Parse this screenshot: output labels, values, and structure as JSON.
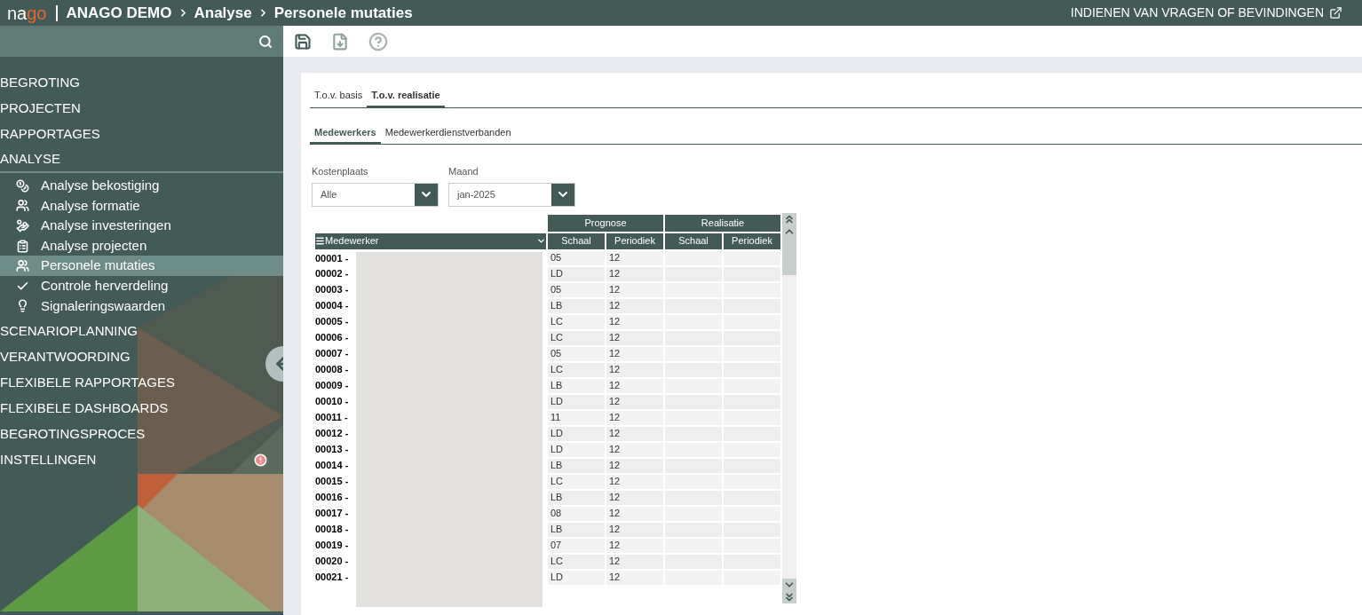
{
  "header": {
    "logo_light": "na",
    "logo_accent": "go",
    "breadcrumb": [
      "ANAGO DEMO",
      "Analyse",
      "Personele mutaties"
    ],
    "feedback_link": "INDIENEN VAN VRAGEN OF BEVINDINGEN"
  },
  "sidebar": {
    "items": [
      {
        "label": "BEGROTING",
        "expanded": false
      },
      {
        "label": "PROJECTEN",
        "expanded": false
      },
      {
        "label": "RAPPORTAGES",
        "expanded": false
      },
      {
        "label": "ANALYSE",
        "expanded": true,
        "children": [
          {
            "label": "Analyse bekostiging",
            "selected": false
          },
          {
            "label": "Analyse formatie",
            "selected": false
          },
          {
            "label": "Analyse investeringen",
            "selected": false
          },
          {
            "label": "Analyse projecten",
            "selected": false
          },
          {
            "label": "Personele mutaties",
            "selected": true
          },
          {
            "label": "Controle herverdeling",
            "selected": false
          },
          {
            "label": "Signaleringswaarden",
            "selected": false
          }
        ]
      },
      {
        "label": "SCENARIOPLANNING",
        "expanded": false
      },
      {
        "label": "VERANTWOORDING",
        "expanded": false
      },
      {
        "label": "FLEXIBELE RAPPORTAGES",
        "expanded": false
      },
      {
        "label": "FLEXIBELE DASHBOARDS",
        "expanded": false
      },
      {
        "label": "BEGROTINGSPROCES",
        "expanded": false
      },
      {
        "label": "INSTELLINGEN",
        "expanded": false,
        "alert": true
      }
    ]
  },
  "tabs": [
    {
      "label": "T.o.v. basis",
      "selected": false
    },
    {
      "label": "T.o.v. realisatie",
      "selected": true
    }
  ],
  "subtabs": [
    {
      "label": "Medewerkers",
      "selected": true
    },
    {
      "label": "Medewerkerdienstverbanden",
      "selected": false
    }
  ],
  "filters": [
    {
      "label": "Kostenplaats",
      "value": "Alle"
    },
    {
      "label": "Maand",
      "value": "jan-2025"
    }
  ],
  "table": {
    "groups": [
      "Prognose",
      "Realisatie"
    ],
    "columns": [
      "Medewerker",
      "Schaal",
      "Periodiek",
      "Schaal",
      "Periodiek"
    ],
    "rows": [
      [
        "00001 -",
        "05",
        "12"
      ],
      [
        "00002 -",
        "LD",
        "12"
      ],
      [
        "00003 -",
        "05",
        "12"
      ],
      [
        "00004 -",
        "LB",
        "12"
      ],
      [
        "00005 -",
        "LC",
        "12"
      ],
      [
        "00006 -",
        "LC",
        "12"
      ],
      [
        "00007 -",
        "05",
        "12"
      ],
      [
        "00008 -",
        "LC",
        "12"
      ],
      [
        "00009 -",
        "LB",
        "12"
      ],
      [
        "00010 -",
        "LD",
        "12"
      ],
      [
        "00011 -",
        "11",
        "12"
      ],
      [
        "00012 -",
        "LD",
        "12"
      ],
      [
        "00013 -",
        "LD",
        "12"
      ],
      [
        "00014 -",
        "LB",
        "12"
      ],
      [
        "00015 -",
        "LC",
        "12"
      ],
      [
        "00016 -",
        "LB",
        "12"
      ],
      [
        "00017 -",
        "08",
        "12"
      ],
      [
        "00018 -",
        "LB",
        "12"
      ],
      [
        "00019 -",
        "07",
        "12"
      ],
      [
        "00020 -",
        "LC",
        "12"
      ],
      [
        "00021 -",
        "LD",
        "12"
      ]
    ]
  }
}
